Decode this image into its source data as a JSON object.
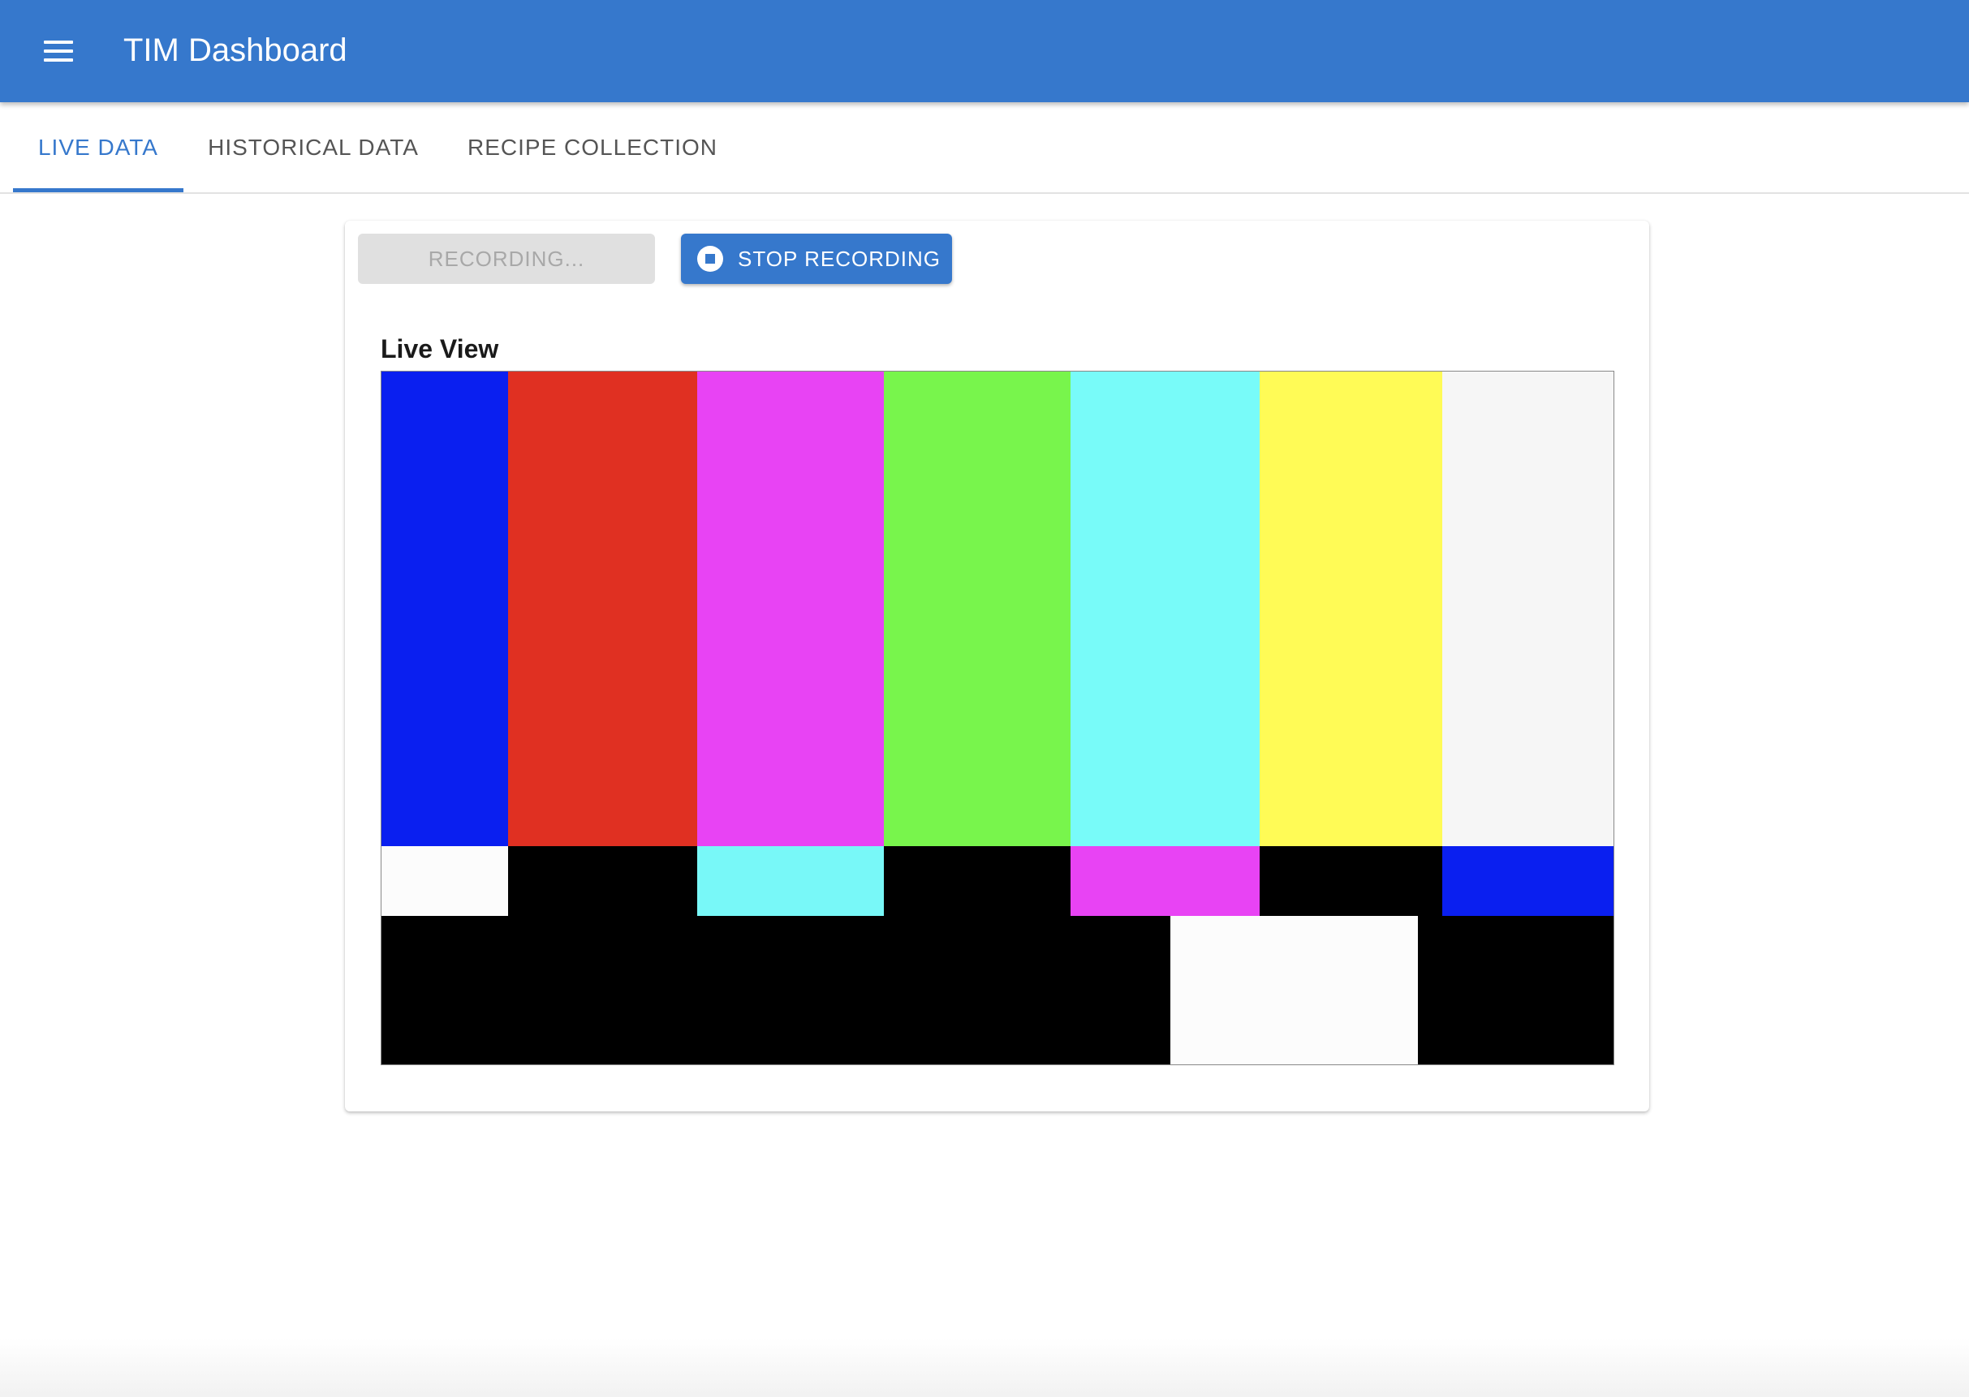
{
  "app": {
    "title": "TIM Dashboard",
    "menu_icon": "menu-icon",
    "brand_color": "#3678cc"
  },
  "tabs": [
    {
      "label": "LIVE DATA",
      "active": true
    },
    {
      "label": "HISTORICAL DATA",
      "active": false
    },
    {
      "label": "RECIPE COLLECTION",
      "active": false
    }
  ],
  "controls": {
    "recording_label": "RECORDING...",
    "recording_disabled": true,
    "stop_label": "STOP RECORDING",
    "stop_icon": "stop-circle-icon"
  },
  "live_view": {
    "title": "Live View",
    "image": "color-bars-test-pattern",
    "top_colors": [
      "#0a1ff0",
      "#e03022",
      "#e843f4",
      "#78f54c",
      "#78fbf9",
      "#fffb56",
      "#f6f6f6"
    ],
    "middle_colors": [
      "#fcfcfc",
      "#000000",
      "#78f8f8",
      "#000000",
      "#e843f4",
      "#000000",
      "#0a1ff0"
    ],
    "bottom_block_color": "#fcfcfc"
  }
}
